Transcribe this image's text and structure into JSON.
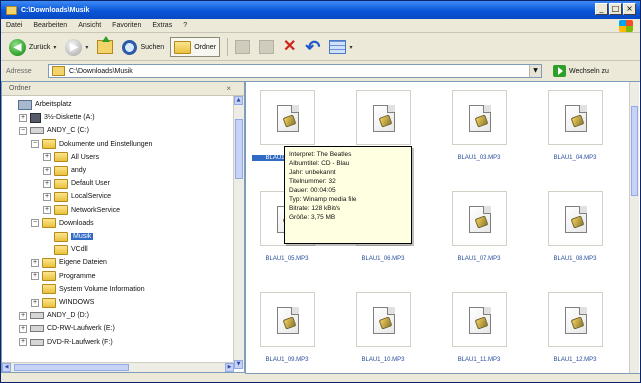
{
  "window": {
    "title": "C:\\Downloads\\Musik",
    "buttons": [
      "_",
      "□",
      "×"
    ]
  },
  "menu": {
    "items": [
      "Datei",
      "Bearbeiten",
      "Ansicht",
      "Favoriten",
      "Extras",
      "?"
    ]
  },
  "toolbar": {
    "back_label": "Zurück",
    "back_arrow": "◀",
    "forward_arrow": "▶",
    "search_label": "Suchen",
    "folders_label": "Ordner"
  },
  "address": {
    "label": "Adresse",
    "value": "C:\\Downloads\\Musik",
    "go_label": "Wechseln zu"
  },
  "folders": {
    "title": "Ordner",
    "close": "×",
    "tree": [
      {
        "label": "Arbeitsplatz",
        "indent": 0,
        "toggle": "",
        "icon": "computer"
      },
      {
        "label": "3½-Diskette (A:)",
        "indent": 1,
        "toggle": "+",
        "icon": "disk"
      },
      {
        "label": "ANDY_C (C:)",
        "indent": 1,
        "toggle": "−",
        "icon": "drive"
      },
      {
        "label": "Dokumente und Einstellungen",
        "indent": 2,
        "toggle": "−",
        "icon": "folder"
      },
      {
        "label": "All Users",
        "indent": 3,
        "toggle": "+",
        "icon": "folder"
      },
      {
        "label": "andy",
        "indent": 3,
        "toggle": "+",
        "icon": "folder"
      },
      {
        "label": "Default User",
        "indent": 3,
        "toggle": "+",
        "icon": "folder"
      },
      {
        "label": "LocalService",
        "indent": 3,
        "toggle": "+",
        "icon": "folder"
      },
      {
        "label": "NetworkService",
        "indent": 3,
        "toggle": "+",
        "icon": "folder"
      },
      {
        "label": "Downloads",
        "indent": 2,
        "toggle": "−",
        "icon": "folder"
      },
      {
        "label": "Musik",
        "indent": 3,
        "toggle": "",
        "icon": "folder",
        "selected": true
      },
      {
        "label": "VCdll",
        "indent": 3,
        "toggle": "",
        "icon": "folder"
      },
      {
        "label": "Eigene Dateien",
        "indent": 2,
        "toggle": "+",
        "icon": "folder"
      },
      {
        "label": "Programme",
        "indent": 2,
        "toggle": "+",
        "icon": "folder"
      },
      {
        "label": "System Volume Information",
        "indent": 2,
        "toggle": "",
        "icon": "folder"
      },
      {
        "label": "WINDOWS",
        "indent": 2,
        "toggle": "+",
        "icon": "folder"
      },
      {
        "label": "ANDY_D (D:)",
        "indent": 1,
        "toggle": "+",
        "icon": "drive"
      },
      {
        "label": "CD-RW-Laufwerk (E:)",
        "indent": 1,
        "toggle": "+",
        "icon": "drive"
      },
      {
        "label": "DVD-R-Laufwerk (F:)",
        "indent": 1,
        "toggle": "+",
        "icon": "drive"
      }
    ]
  },
  "files": [
    {
      "name": "BLAU1_01.MP3",
      "selected": true
    },
    {
      "name": "BLAU1_02.MP3"
    },
    {
      "name": "BLAU1_03.MP3"
    },
    {
      "name": "BLAU1_04.MP3"
    },
    {
      "name": "BLAU1_05.MP3"
    },
    {
      "name": "BLAU1_06.MP3"
    },
    {
      "name": "BLAU1_07.MP3"
    },
    {
      "name": "BLAU1_08.MP3"
    },
    {
      "name": "BLAU1_09.MP3"
    },
    {
      "name": "BLAU1_10.MP3"
    },
    {
      "name": "BLAU1_11.MP3"
    },
    {
      "name": "BLAU1_12.MP3"
    }
  ],
  "tooltip": {
    "lines": [
      "Interpret: The Beatles",
      "Albumtitel: CD - Blau",
      "Jahr: unbekannt",
      "Titelnummer: 32",
      "Dauer: 00:04:05",
      "Typ: Winamp media file",
      "Bitrate: 128 kBit/s",
      "Größe: 3,75 MB"
    ]
  },
  "colors": {
    "title_bar": "#0a55d8",
    "selection": "#316ac5",
    "tooltip": "#ffffe1"
  }
}
